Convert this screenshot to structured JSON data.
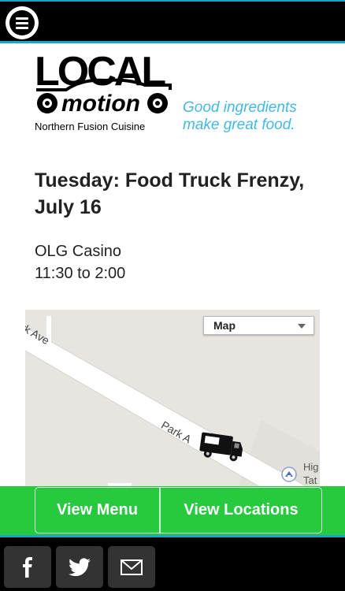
{
  "header": {
    "menu_icon": "hamburger-menu-icon"
  },
  "brand": {
    "name": "LOCAL motion",
    "subtitle": "Northern Fusion Cuisine",
    "tagline_line1": "Good ingredients",
    "tagline_line2": "make great food.",
    "accent_color": "#43b8e8"
  },
  "event": {
    "title": "Tuesday: Food Truck Frenzy, July 16",
    "location": "OLG Casino",
    "time": "11:30 to 2:00"
  },
  "map": {
    "type_selected": "Map",
    "street_label_1": "rk Ave",
    "street_label_2": "Park A",
    "poi_label_line1": "Hig",
    "poi_label_line2": "Tat",
    "marker_icon": "food-truck-icon"
  },
  "actions": {
    "view_menu": "View Menu",
    "view_locations": "View Locations",
    "color": "#27c93f"
  },
  "footer": {
    "social": [
      "facebook-icon",
      "twitter-icon",
      "email-icon"
    ],
    "accent_color": "#1aa6c9"
  }
}
